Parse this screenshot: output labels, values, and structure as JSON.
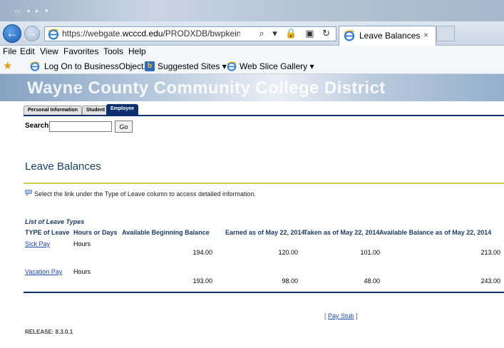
{
  "browser": {
    "url_prefix": "https://webgate.",
    "url_domain": "wcccd.edu",
    "url_suffix": "/PRODXDB/bwpkeinf.P_ViewLe",
    "address_tools": "⌕ ▾ 🔒 ▣ ↻",
    "tab_title": "Leave Balances",
    "tab_close": "×",
    "menu": [
      "File",
      "Edit",
      "View",
      "Favorites",
      "Tools",
      "Help"
    ],
    "favorites": [
      {
        "label": "Log On to BusinessObject..."
      },
      {
        "label": "Suggested Sites ▾"
      },
      {
        "label": "Web Slice Gallery ▾"
      }
    ]
  },
  "banner": {
    "title": "Wayne County Community College District"
  },
  "ssb_tabs": [
    "Personal Information",
    "Student",
    "Employee"
  ],
  "search": {
    "label": "Search",
    "value": "",
    "button": "Go"
  },
  "page": {
    "title": "Leave Balances",
    "info": "Select the link under the Type of Leave column to access detailed information."
  },
  "table": {
    "caption": "List of Leave Types",
    "headers": [
      "TYPE of Leave",
      "Hours or Days",
      "Available Beginning Balance",
      "Earned as of May 22, 2014",
      "Taken as of May 22, 2014",
      "Available Balance as of May 22, 2014"
    ],
    "rows": [
      {
        "type": "Sick Pay",
        "unit": "Hours",
        "beginning": "194.00",
        "earned": "120.00",
        "taken": "101.00",
        "available": "213.00"
      },
      {
        "type": "Vacation Pay",
        "unit": "Hours",
        "beginning": "193.00",
        "earned": "98.00",
        "taken": "48.00",
        "available": "243.00"
      }
    ]
  },
  "footer": {
    "paystub_open": "[",
    "paystub": "Pay Stub",
    "paystub_close": "]",
    "release": "RELEASE: 8.3.0.1"
  },
  "colors": {
    "ssb_navy": "#0e2f6e",
    "title_blue": "#17416f",
    "rule_yellow": "#cbcf4a",
    "link_blue": "#1a48a8"
  }
}
